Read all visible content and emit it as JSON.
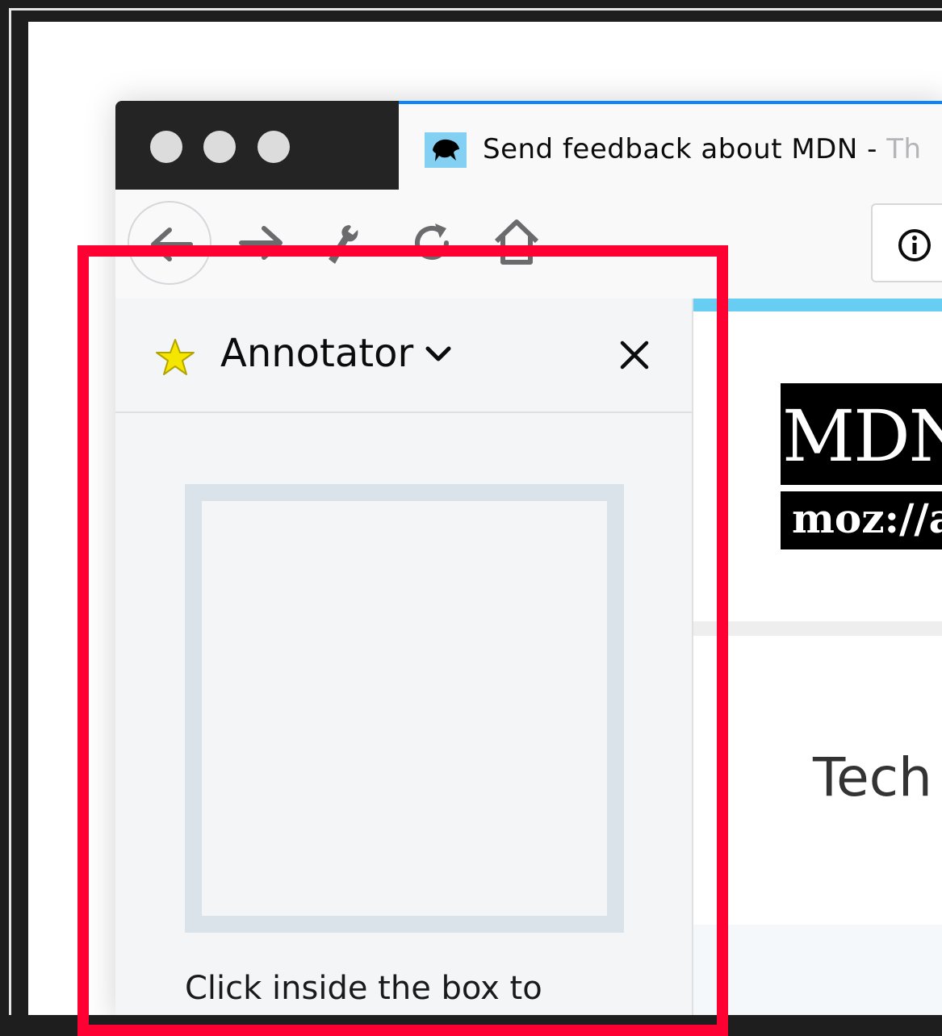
{
  "browser": {
    "tab": {
      "title": "Send feedback about MDN - ",
      "title_faded": "Th"
    }
  },
  "sidebar": {
    "title": "Annotator",
    "instructions": "Click inside the box to"
  },
  "content": {
    "logo_top": "MDN",
    "logo_bottom": "moz://a",
    "heading": "Tech"
  },
  "colors": {
    "highlight": "#ff0033",
    "tab_accent": "#0a84ff",
    "load_bar": "#68cdf2",
    "star": "#f5e600"
  }
}
